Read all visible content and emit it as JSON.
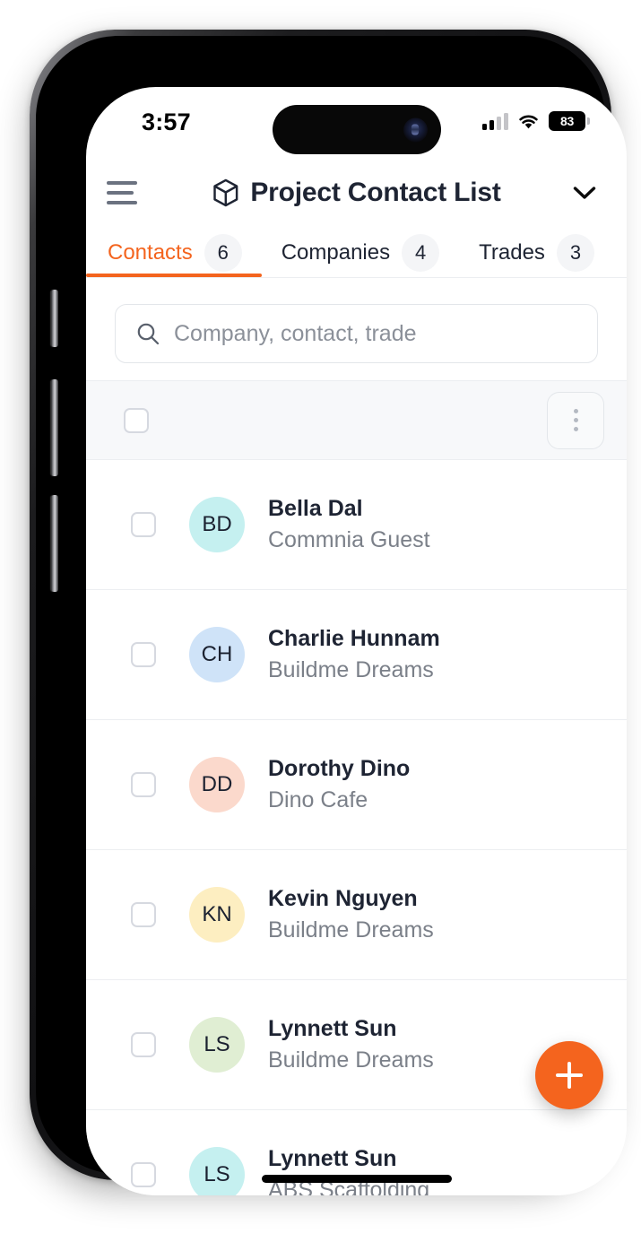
{
  "status_bar": {
    "time": "3:57",
    "battery_percent": "83",
    "signal_icon": "cellular-signal-icon",
    "wifi_icon": "wifi-icon",
    "battery_icon": "battery-icon"
  },
  "header": {
    "menu_icon": "hamburger-menu-icon",
    "project_icon": "cube-icon",
    "title": "Project Contact List",
    "dropdown_icon": "chevron-down-icon"
  },
  "tabs": [
    {
      "label": "Contacts",
      "count": "6",
      "active": true
    },
    {
      "label": "Companies",
      "count": "4",
      "active": false
    },
    {
      "label": "Trades",
      "count": "3",
      "active": false
    }
  ],
  "search": {
    "icon": "search-icon",
    "placeholder": "Company, contact, trade",
    "value": ""
  },
  "bulk_bar": {
    "select_all_checked": false,
    "overflow_icon": "more-vertical-icon"
  },
  "contacts": [
    {
      "initials": "BD",
      "name": "Bella Dal",
      "company": "Commnia Guest",
      "avatar_color": "#c5f0f0",
      "checked": false
    },
    {
      "initials": "CH",
      "name": "Charlie Hunnam",
      "company": "Buildme Dreams",
      "avatar_color": "#cfe3f8",
      "checked": false
    },
    {
      "initials": "DD",
      "name": "Dorothy Dino",
      "company": "Dino Cafe",
      "avatar_color": "#fbd9cc",
      "checked": false
    },
    {
      "initials": "KN",
      "name": "Kevin Nguyen",
      "company": "Buildme Dreams",
      "avatar_color": "#fdeec1",
      "checked": false
    },
    {
      "initials": "LS",
      "name": "Lynnett Sun",
      "company": "Buildme Dreams",
      "avatar_color": "#e0eed3",
      "checked": false
    },
    {
      "initials": "LS",
      "name": "Lynnett Sun",
      "company": "ABS Scaffolding",
      "avatar_color": "#c5f0f0",
      "checked": false
    }
  ],
  "fab": {
    "icon": "plus-icon",
    "label": "Add"
  },
  "colors": {
    "accent": "#f4641e",
    "text_primary": "#1e2433",
    "text_secondary": "#7b8089",
    "bar_background": "#f7f8fa",
    "border": "#eceef1"
  }
}
